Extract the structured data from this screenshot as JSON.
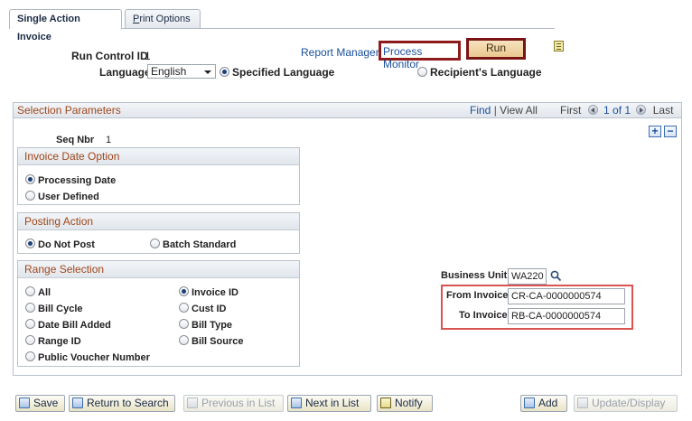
{
  "tabs": [
    {
      "label": "Single Action Invoice"
    },
    {
      "label_prefix": "P",
      "label_rest": "rint Options"
    }
  ],
  "run_control": {
    "label": "Run Control ID",
    "value": "1"
  },
  "links": {
    "report_manager": "Report Manager",
    "process_monitor": "Process Monitor"
  },
  "run_button": "Run",
  "language": {
    "label": "Language",
    "selected": "English",
    "specified": "Specified Language",
    "recipient": "Recipient's Language"
  },
  "section": {
    "title": "Selection Parameters",
    "find": "Find",
    "sep": "|",
    "view_all": "View All",
    "first": "First",
    "count": "1 of 1",
    "last": "Last"
  },
  "seq": {
    "label": "Seq Nbr",
    "value": "1"
  },
  "invoice_date": {
    "title": "Invoice Date Option",
    "options": [
      "Processing Date",
      "User Defined"
    ]
  },
  "posting": {
    "title": "Posting Action",
    "options": [
      "Do Not Post",
      "Batch Standard"
    ]
  },
  "range": {
    "title": "Range Selection",
    "left": [
      "All",
      "Bill Cycle",
      "Date Bill Added",
      "Range ID",
      "Public Voucher Number"
    ],
    "right": [
      "Invoice ID",
      "Cust ID",
      "Bill Type",
      "Bill Source"
    ]
  },
  "fields": {
    "business_unit_label": "Business Unit",
    "business_unit_value": "WA220",
    "from_invoice_label": "From Invoice",
    "from_invoice_value": "CR-CA-0000000574",
    "to_invoice_label": "To Invoice",
    "to_invoice_value": "RB-CA-0000000574"
  },
  "toolbar": {
    "save": "Save",
    "return": "Return to Search",
    "previous": "Previous in List",
    "next": "Next in List",
    "notify": "Notify",
    "add": "Add",
    "update": "Update/Display"
  },
  "colors": {
    "highlight": "#d9534f",
    "run_border": "#7a1414",
    "section_title": "#a0461a"
  }
}
